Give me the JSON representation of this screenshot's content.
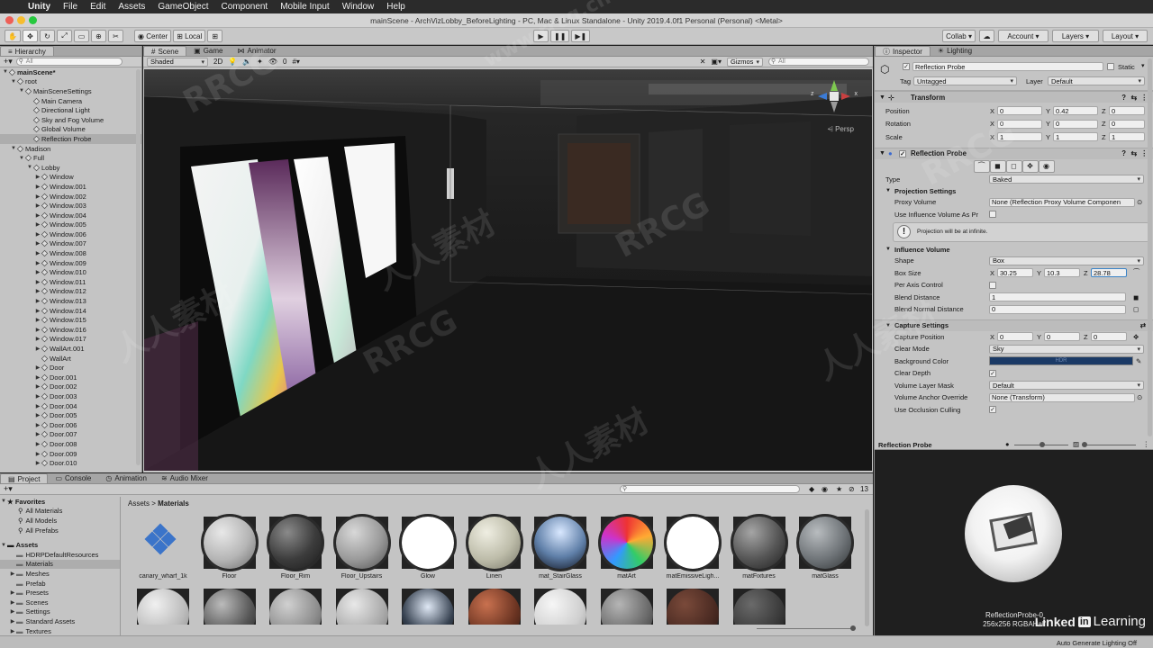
{
  "menubar": {
    "app": "Unity",
    "items": [
      "File",
      "Edit",
      "Assets",
      "GameObject",
      "Component",
      "Mobile Input",
      "Window",
      "Help"
    ]
  },
  "window": {
    "title": "mainScene - ArchVizLobby_BeforeLighting - PC, Mac & Linux Standalone - Unity 2019.4.0f1 Personal (Personal) <Metal>"
  },
  "toolbar": {
    "pivot_mode": "Center",
    "pivot_space": "Local",
    "collab": "Collab",
    "account": "Account",
    "layers": "Layers",
    "layout": "Layout"
  },
  "hierarchy": {
    "tab": "Hierarchy",
    "search_placeholder": "All",
    "rows": [
      {
        "label": "mainScene*",
        "depth": 0,
        "arrow": "▼",
        "icon": false,
        "bold": true
      },
      {
        "label": "root",
        "depth": 1,
        "arrow": "▼",
        "icon": true
      },
      {
        "label": "MainSceneSettings",
        "depth": 2,
        "arrow": "▼",
        "icon": true
      },
      {
        "label": "Main Camera",
        "depth": 3,
        "arrow": "",
        "icon": true
      },
      {
        "label": "Directional Light",
        "depth": 3,
        "arrow": "",
        "icon": true
      },
      {
        "label": "Sky and Fog Volume",
        "depth": 3,
        "arrow": "",
        "icon": true
      },
      {
        "label": "Global Volume",
        "depth": 3,
        "arrow": "",
        "icon": true
      },
      {
        "label": "Reflection Probe",
        "depth": 3,
        "arrow": "",
        "icon": true,
        "selected": true
      },
      {
        "label": "Madison",
        "depth": 1,
        "arrow": "▼",
        "icon": true
      },
      {
        "label": "Full",
        "depth": 2,
        "arrow": "▼",
        "icon": true
      },
      {
        "label": "Lobby",
        "depth": 3,
        "arrow": "▼",
        "icon": true
      },
      {
        "label": "Window",
        "depth": 4,
        "arrow": "▶",
        "icon": true
      },
      {
        "label": "Window.001",
        "depth": 4,
        "arrow": "▶",
        "icon": true
      },
      {
        "label": "Window.002",
        "depth": 4,
        "arrow": "▶",
        "icon": true
      },
      {
        "label": "Window.003",
        "depth": 4,
        "arrow": "▶",
        "icon": true
      },
      {
        "label": "Window.004",
        "depth": 4,
        "arrow": "▶",
        "icon": true
      },
      {
        "label": "Window.005",
        "depth": 4,
        "arrow": "▶",
        "icon": true
      },
      {
        "label": "Window.006",
        "depth": 4,
        "arrow": "▶",
        "icon": true
      },
      {
        "label": "Window.007",
        "depth": 4,
        "arrow": "▶",
        "icon": true
      },
      {
        "label": "Window.008",
        "depth": 4,
        "arrow": "▶",
        "icon": true
      },
      {
        "label": "Window.009",
        "depth": 4,
        "arrow": "▶",
        "icon": true
      },
      {
        "label": "Window.010",
        "depth": 4,
        "arrow": "▶",
        "icon": true
      },
      {
        "label": "Window.011",
        "depth": 4,
        "arrow": "▶",
        "icon": true
      },
      {
        "label": "Window.012",
        "depth": 4,
        "arrow": "▶",
        "icon": true
      },
      {
        "label": "Window.013",
        "depth": 4,
        "arrow": "▶",
        "icon": true
      },
      {
        "label": "Window.014",
        "depth": 4,
        "arrow": "▶",
        "icon": true
      },
      {
        "label": "Window.015",
        "depth": 4,
        "arrow": "▶",
        "icon": true
      },
      {
        "label": "Window.016",
        "depth": 4,
        "arrow": "▶",
        "icon": true
      },
      {
        "label": "Window.017",
        "depth": 4,
        "arrow": "▶",
        "icon": true
      },
      {
        "label": "WallArt.001",
        "depth": 4,
        "arrow": "▶",
        "icon": true
      },
      {
        "label": "WallArt",
        "depth": 4,
        "arrow": "",
        "icon": true
      },
      {
        "label": "Door",
        "depth": 4,
        "arrow": "▶",
        "icon": true
      },
      {
        "label": "Door.001",
        "depth": 4,
        "arrow": "▶",
        "icon": true
      },
      {
        "label": "Door.002",
        "depth": 4,
        "arrow": "▶",
        "icon": true
      },
      {
        "label": "Door.003",
        "depth": 4,
        "arrow": "▶",
        "icon": true
      },
      {
        "label": "Door.004",
        "depth": 4,
        "arrow": "▶",
        "icon": true
      },
      {
        "label": "Door.005",
        "depth": 4,
        "arrow": "▶",
        "icon": true
      },
      {
        "label": "Door.006",
        "depth": 4,
        "arrow": "▶",
        "icon": true
      },
      {
        "label": "Door.007",
        "depth": 4,
        "arrow": "▶",
        "icon": true
      },
      {
        "label": "Door.008",
        "depth": 4,
        "arrow": "▶",
        "icon": true
      },
      {
        "label": "Door.009",
        "depth": 4,
        "arrow": "▶",
        "icon": true
      },
      {
        "label": "Door.010",
        "depth": 4,
        "arrow": "▶",
        "icon": true
      }
    ]
  },
  "scene": {
    "tabs": [
      "Scene",
      "Game",
      "Animator"
    ],
    "shading": "Shaded",
    "mode2d": "2D",
    "fx_count": "0",
    "gizmos": "Gizmos",
    "search_placeholder": "All",
    "persp": "Persp",
    "axis_x": "x",
    "axis_z": "z"
  },
  "inspector": {
    "tabs": [
      "Inspector",
      "Lighting"
    ],
    "object_name": "Reflection Probe",
    "static": "Static",
    "tag_label": "Tag",
    "tag": "Untagged",
    "layer_label": "Layer",
    "layer": "Default",
    "transform": {
      "title": "Transform",
      "rows": [
        {
          "label": "Position",
          "x": "0",
          "y": "0.42",
          "z": "0"
        },
        {
          "label": "Rotation",
          "x": "0",
          "y": "0",
          "z": "0"
        },
        {
          "label": "Scale",
          "x": "1",
          "y": "1",
          "z": "1"
        }
      ]
    },
    "probe": {
      "title": "Reflection Probe",
      "type_label": "Type",
      "type": "Baked",
      "projection_title": "Projection Settings",
      "proxy_label": "Proxy Volume",
      "proxy": "None (Reflection Proxy Volume Componen",
      "use_influence_label": "Use Influence Volume As Pr",
      "info": "Projection will be at infinite.",
      "influence_title": "Influence Volume",
      "shape_label": "Shape",
      "shape": "Box",
      "box_size_label": "Box Size",
      "box_x": "30.25",
      "box_y": "10.3",
      "box_z": "28.78",
      "per_axis_label": "Per Axis Control",
      "blend_label": "Blend Distance",
      "blend": "1",
      "blend_normal_label": "Blend Normal Distance",
      "blend_normal": "0",
      "capture_title": "Capture Settings",
      "capture_pos_label": "Capture Position",
      "cx": "0",
      "cy": "0",
      "cz": "0",
      "clear_mode_label": "Clear Mode",
      "clear_mode": "Sky",
      "bg_color_label": "Background Color",
      "bg_color_text": "HDR",
      "clear_depth_label": "Clear Depth",
      "volume_mask_label": "Volume Layer Mask",
      "volume_mask": "Default",
      "anchor_label": "Volume Anchor Override",
      "anchor": "None (Transform)",
      "occlusion_label": "Use Occlusion Culling"
    },
    "preview_title": "Reflection Probe",
    "preview_caption1": "ReflectionProbe-0",
    "preview_caption2": "256x256 RGBAHalf"
  },
  "bottom_tabs": [
    "Project",
    "Console",
    "Animation",
    "Audio Mixer"
  ],
  "project": {
    "favorites_title": "Favorites",
    "favorites": [
      "All Materials",
      "All Models",
      "All Prefabs"
    ],
    "assets_title": "Assets",
    "folders": [
      "HDRPDefaultResources",
      "Materials",
      "Meshes",
      "Prefab",
      "Presets",
      "Scenes",
      "Settings",
      "Standard Assets",
      "Textures"
    ],
    "breadcrumb_root": "Assets",
    "breadcrumb_current": "Materials",
    "hidden_count": "13",
    "materials": [
      "canary_wharf_1k",
      "Floor",
      "Floor_Rim",
      "Floor_Upstairs",
      "Glow",
      "Linen",
      "mat_StairGlass",
      "matArt",
      "matEmissiveLigh...",
      "matFixtures",
      "matGlass"
    ]
  },
  "status": {
    "text": "Auto Generate Lighting Off"
  },
  "branding": {
    "learning": "Learning",
    "in": "in",
    "linked": "Linked"
  },
  "watermarks": [
    "RRCG",
    "人人素材",
    "RRCG",
    "人人素材",
    "RRCG",
    "人人素材",
    "RRCG",
    "人人素材",
    "www.rrcg.cn"
  ],
  "colors": {
    "accent_blue": "#3b83c6",
    "selection": "#adadad",
    "bg_color_swatch": "#1b3a66"
  }
}
